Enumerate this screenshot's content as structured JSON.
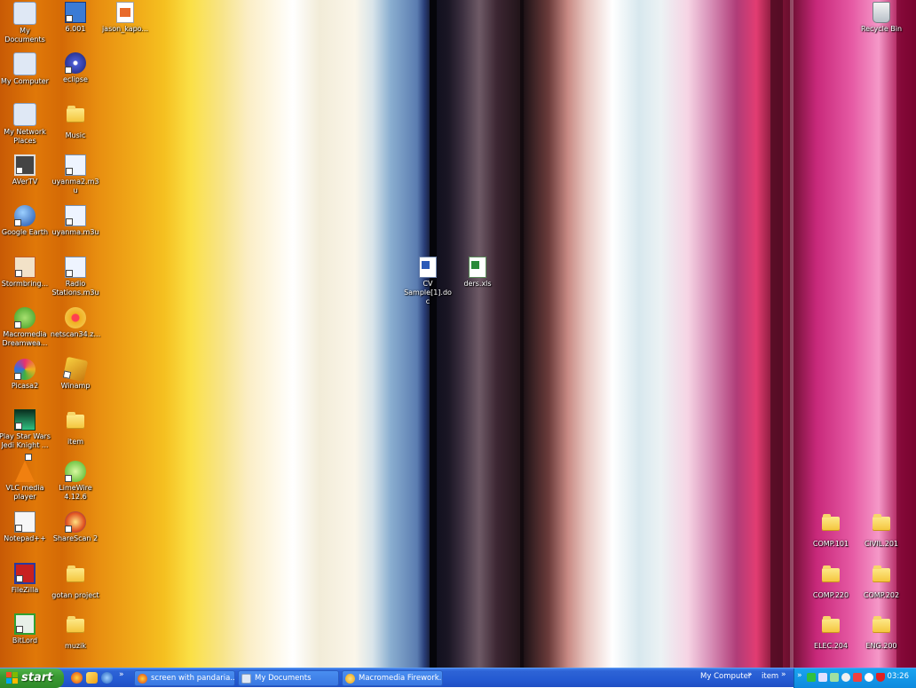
{
  "desktop_icons_left": [
    {
      "id": "my-documents",
      "label": "My Documents",
      "color": "#d9e6f5"
    },
    {
      "id": "6001",
      "label": "6.001",
      "color": "#3a7bd5"
    },
    {
      "id": "jason-kapo",
      "label": "jason_kapo...",
      "color": "#e86a2a"
    },
    {
      "id": "my-computer",
      "label": "My Computer",
      "color": "#d9e6f5"
    },
    {
      "id": "eclipse",
      "label": "eclipse",
      "color": "#3a4aa8"
    },
    {
      "id": "my-network-places",
      "label": "My Network Places",
      "color": "#d9e6f5"
    },
    {
      "id": "music",
      "label": "Music",
      "color": "#f4c43a"
    },
    {
      "id": "avertv",
      "label": "AVerTV",
      "color": "#3a3a3a"
    },
    {
      "id": "uyanma2",
      "label": "uyanma2.m3u",
      "color": "#e8a030"
    },
    {
      "id": "google-earth",
      "label": "Google Earth",
      "color": "#2a6ac8"
    },
    {
      "id": "uyanma",
      "label": "uyanma.m3u",
      "color": "#e8a030"
    },
    {
      "id": "stormbring",
      "label": "Stormbring...",
      "color": "#e85030"
    },
    {
      "id": "radio-stations",
      "label": "Radio Stations.m3u",
      "color": "#e8a030"
    },
    {
      "id": "dreamweaver",
      "label": "Macromedia Dreamwea...",
      "color": "#58b830"
    },
    {
      "id": "netscan",
      "label": "netscan34.z...",
      "color": "#f0b020"
    },
    {
      "id": "picasa",
      "label": "Picasa2",
      "color": "#d83080"
    },
    {
      "id": "winamp",
      "label": "Winamp",
      "color": "#f0b020"
    },
    {
      "id": "star-wars",
      "label": "Play Star Wars Jedi Knight ...",
      "color": "#208040"
    },
    {
      "id": "item",
      "label": "item",
      "color": "#f4c43a"
    },
    {
      "id": "vlc",
      "label": "VLC media player",
      "color": "#f08010"
    },
    {
      "id": "limewire",
      "label": "LimeWire 4.12.6",
      "color": "#48b020"
    },
    {
      "id": "notepadpp",
      "label": "Notepad++",
      "color": "#58a040"
    },
    {
      "id": "sharescan",
      "label": "ShareScan 2",
      "color": "#e05020"
    },
    {
      "id": "filezilla",
      "label": "FileZilla",
      "color": "#c82020"
    },
    {
      "id": "gotan-project",
      "label": "gotan project",
      "color": "#f4c43a"
    },
    {
      "id": "bitlord",
      "label": "BitLord",
      "color": "#30a030"
    },
    {
      "id": "muzik",
      "label": "muzik",
      "color": "#f4c43a"
    }
  ],
  "desktop_icons_center": [
    {
      "id": "cv-sample",
      "label": "CV Sample[1].doc"
    },
    {
      "id": "ders-xls",
      "label": "ders.xls"
    }
  ],
  "desktop_icons_right": [
    {
      "id": "recycle-bin",
      "label": "Recycle Bin"
    },
    {
      "id": "comp101",
      "label": "COMP.101"
    },
    {
      "id": "civil201",
      "label": "CIVIL.201"
    },
    {
      "id": "comp220",
      "label": "COMP.220"
    },
    {
      "id": "comp202",
      "label": "COMP.202"
    },
    {
      "id": "elec204",
      "label": "ELEC.204"
    },
    {
      "id": "eng200",
      "label": "ENG.200"
    }
  ],
  "taskbar": {
    "start_label": "start",
    "quick_launch_more": "»",
    "windows": [
      {
        "label": "screen with pandaria..."
      },
      {
        "label": "My Documents"
      },
      {
        "label": "Macromedia Firework..."
      }
    ],
    "toolbar_more_1": "»",
    "toolbar_label_1": "My Computer",
    "toolbar_more_2": "»",
    "toolbar_label_2": "item",
    "toolbar_more_3": "»",
    "clock": "03:26"
  }
}
